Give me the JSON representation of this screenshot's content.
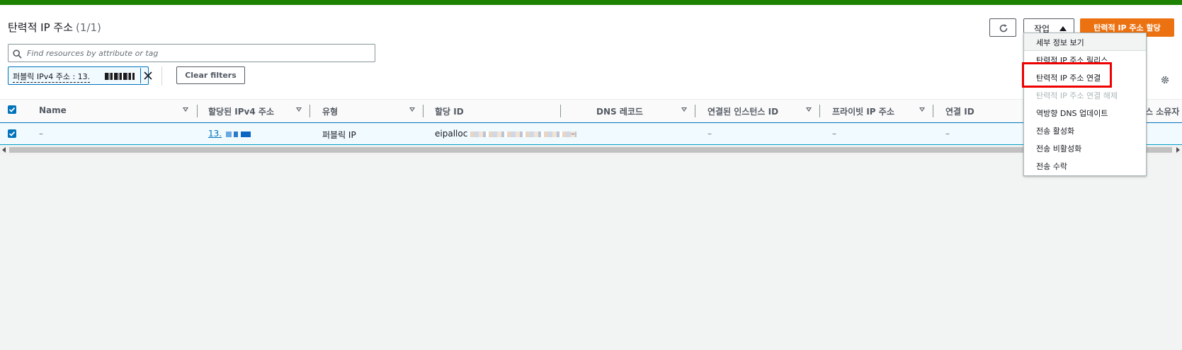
{
  "page": {
    "title": "탄력적 IP 주소",
    "count": "(1/1)"
  },
  "search": {
    "placeholder": "Find resources by attribute or tag"
  },
  "filter_token": {
    "label": "퍼블릭 IPv4 주소 : 13."
  },
  "buttons": {
    "clear_filters": "Clear filters",
    "actions": "작업",
    "allocate": "탄력적 IP 주소 할당"
  },
  "table": {
    "columns": [
      "Name",
      "할당된 IPv4 주소",
      "유형",
      "할당 ID",
      "DNS 레코드",
      "연결된 인스턴스 ID",
      "프라이빗 IP 주소",
      "연결 ID",
      "스 소유자"
    ],
    "row": {
      "name": "–",
      "ipv4": "13.",
      "type": "퍼블릭 IP",
      "allocation_id": "eipalloc",
      "dns": "–",
      "instance_id": "–",
      "private_ip": "–",
      "association_id": "–"
    }
  },
  "menu": {
    "items": [
      {
        "label": "세부 정보 보기",
        "enabled": true
      },
      {
        "label": "탄력적 IP 주소 릴리스",
        "enabled": true
      },
      {
        "label": "탄력적 IP 주소 연결",
        "enabled": true
      },
      {
        "label": "탄력적 IP 주소 연결 해제",
        "enabled": false
      },
      {
        "label": "역방향 DNS 업데이트",
        "enabled": true
      },
      {
        "label": "전송 활성화",
        "enabled": true
      },
      {
        "label": "전송 비활성화",
        "enabled": true
      },
      {
        "label": "전송 수락",
        "enabled": true
      }
    ]
  },
  "colors": {
    "accent": "#ec7211",
    "link": "#0073bb",
    "header_bar": "#1d8102",
    "highlight": "#ee0000"
  },
  "icons": [
    "refresh-icon",
    "gear-icon",
    "search-icon",
    "close-icon",
    "checkbox-checked-icon",
    "caret-up-icon"
  ]
}
